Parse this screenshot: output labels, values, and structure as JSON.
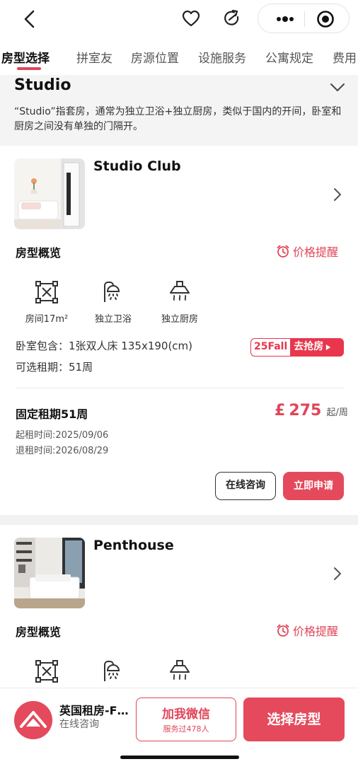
{
  "nav": {
    "icons": [
      "back-icon",
      "heart-icon",
      "share-icon",
      "more-icon",
      "target-icon"
    ]
  },
  "tabs": [
    {
      "label": "房型选择",
      "active": true
    },
    {
      "label": "拼室友"
    },
    {
      "label": "房源位置"
    },
    {
      "label": "设施服务"
    },
    {
      "label": "公寓规定"
    },
    {
      "label": "费用"
    }
  ],
  "intro": {
    "title": "Studio",
    "description": "“Studio”指套房，通常为独立卫浴+独立厨房，类似于国内的开间，卧室和厨房之间没有单独的门隔开。"
  },
  "rooms": [
    {
      "name": "Studio Club",
      "overview_label": "房型概览",
      "price_alert": "价格提醒",
      "amenities": [
        {
          "icon": "room-size-icon",
          "label": "房间17m²"
        },
        {
          "icon": "shower-icon",
          "label": "独立卫浴"
        },
        {
          "icon": "range-hood-icon",
          "label": "独立厨房"
        }
      ],
      "bedroom": "卧室包含：1张双人床 135x190(cm)",
      "lease_options": "可选租期：51周",
      "promo_code": "25Fall",
      "promo_action": "去抢房",
      "lease_title": "固定租期51周",
      "currency": "£",
      "price": "275",
      "price_unit": "起/周",
      "start_date": "起租时间:2025/09/06",
      "end_date": "退租时间:2026/08/29",
      "consult_label": "在线咨询",
      "apply_label": "立即申请"
    },
    {
      "name": "Penthouse",
      "overview_label": "房型概览",
      "price_alert": "价格提醒"
    }
  ],
  "bottom": {
    "agency_name": "英国租房-F…",
    "agency_sub": "在线咨询",
    "wechat_label": "加我微信",
    "wechat_sub": "服务过478人",
    "select_label": "选择房型"
  },
  "colors": {
    "accent": "#e44a5c",
    "accent_text": "#e04558"
  }
}
